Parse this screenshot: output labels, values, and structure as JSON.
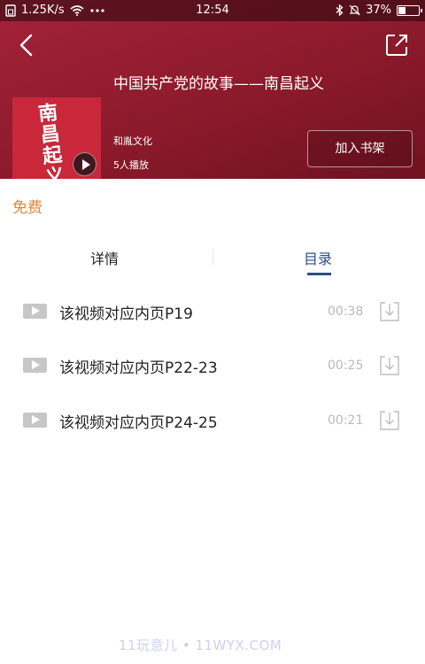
{
  "status_bar": {
    "network_speed": "1.25K/s",
    "time": "12:54",
    "battery": "37%",
    "battery_level": 0.37
  },
  "book": {
    "title": "中国共产党的故事——南昌起义",
    "publisher": "和胤文化",
    "plays": "5人播放",
    "cover_text": "南昌起义",
    "add_shelf_label": "加入书架"
  },
  "price_tag": "免费",
  "tabs": [
    {
      "label": "详情",
      "active": false
    },
    {
      "label": "目录",
      "active": true
    }
  ],
  "catalog": [
    {
      "title": "该视频对应内页P19",
      "duration": "00:38"
    },
    {
      "title": "该视频对应内页P22-23",
      "duration": "00:25"
    },
    {
      "title": "该视频对应内页P24-25",
      "duration": "00:21"
    }
  ],
  "watermark": "11玩意儿 • 11WYX.COM",
  "colors": {
    "header": "#8c1a2b",
    "accent_orange": "#e0853a",
    "tab_active": "#2e4d87"
  }
}
